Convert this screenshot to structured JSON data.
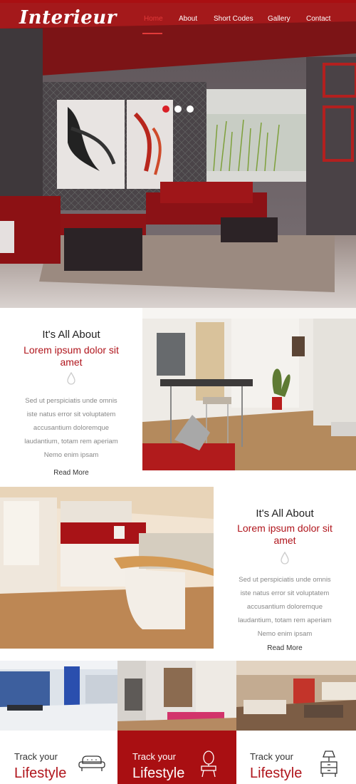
{
  "header": {
    "logo": "Interieur",
    "nav": [
      "Home",
      "About",
      "Short Codes",
      "Gallery",
      "Contact"
    ],
    "active_index": 0,
    "accent": "#a90f12"
  },
  "hero": {
    "slide_count": 3,
    "active_slide": 0
  },
  "features": [
    {
      "title": "It's All About",
      "subtitle_line1": "Lorem ipsum dolor sit",
      "subtitle_line2": "amet",
      "icon": "water-drop-icon",
      "body": [
        "Sed ut perspiciatis unde omnis",
        "iste natus error sit voluptatem",
        "accusantium doloremque",
        "laudantium, totam rem aperiam",
        "Nemo enim ipsam"
      ],
      "link": "Read More"
    },
    {
      "title": "It's All About",
      "subtitle_line1": "Lorem ipsum dolor sit",
      "subtitle_line2": "amet",
      "icon": "water-drop-icon",
      "body": [
        "Sed ut perspiciatis unde omnis",
        "iste natus error sit voluptatem",
        "accusantium doloremque",
        "laudantium, totam rem aperiam",
        "Nemo enim ipsam"
      ],
      "link": "Read More"
    }
  ],
  "bottom_cards": [
    {
      "line1": "Track your",
      "line2": "Lifestyle",
      "icon": "sofa-icon"
    },
    {
      "line1": "Track your",
      "line2": "Lifestyle",
      "icon": "vanity-mirror-icon"
    },
    {
      "line1": "Track your",
      "line2": "Lifestyle",
      "icon": "lamp-table-icon"
    }
  ]
}
